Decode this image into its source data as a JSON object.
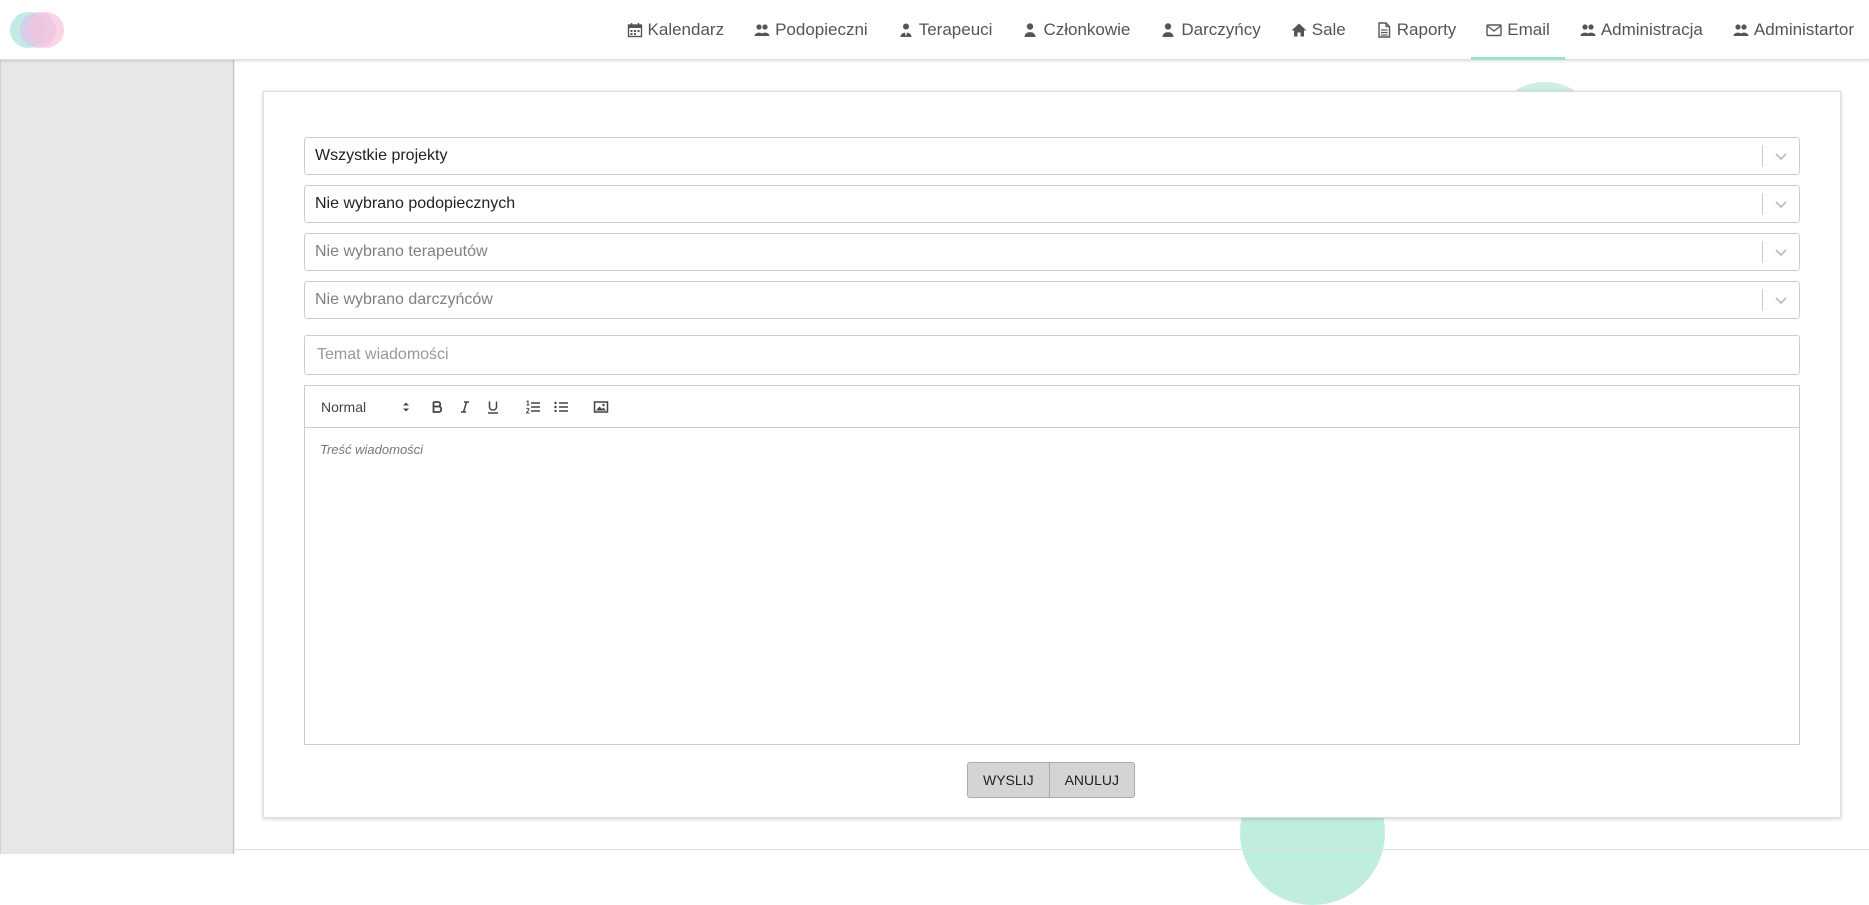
{
  "nav": {
    "items": [
      {
        "label": "Kalendarz",
        "icon": "calendar-icon"
      },
      {
        "label": "Podopieczni",
        "icon": "users-icon"
      },
      {
        "label": "Terapeuci",
        "icon": "user-tie-icon"
      },
      {
        "label": "Członkowie",
        "icon": "user-icon"
      },
      {
        "label": "Darczyńcy",
        "icon": "user-icon"
      },
      {
        "label": "Sale",
        "icon": "home-icon"
      },
      {
        "label": "Raporty",
        "icon": "file-icon"
      },
      {
        "label": "Email",
        "icon": "envelope-icon"
      },
      {
        "label": "Administracja",
        "icon": "users-icon"
      },
      {
        "label": "Administartor",
        "icon": "users-icon"
      }
    ],
    "active_index": 7,
    "active_color": "#9be3c6"
  },
  "form": {
    "project_select": "Wszystkie projekty",
    "wards_select": "Nie wybrano podopiecznych",
    "therapists_select": "Nie wybrano terapeutów",
    "donors_select": "Nie wybrano darczyńców",
    "subject_placeholder": "Temat wiadomości",
    "subject_value": "",
    "body_placeholder": "Treść wiadomości"
  },
  "editor": {
    "format_label": "Normal",
    "tools": [
      "bold-icon",
      "italic-icon",
      "underline-icon",
      "ordered-list-icon",
      "bullet-list-icon",
      "image-icon"
    ]
  },
  "actions": {
    "send_label": "WYSLIJ",
    "cancel_label": "ANULUJ"
  },
  "colors": {
    "sidebar_bg": "#e7e7e7",
    "button_bg": "#d4d4d4",
    "accent": "#9be3c6"
  }
}
